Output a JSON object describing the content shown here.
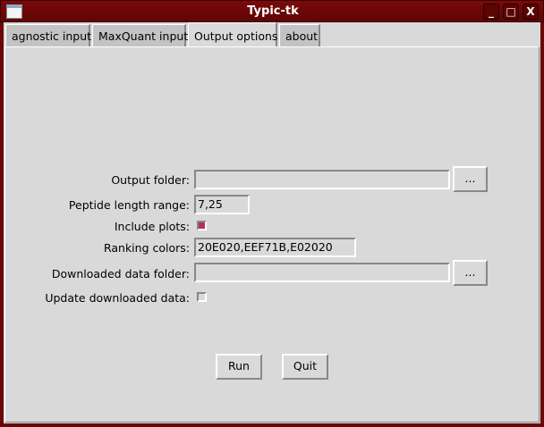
{
  "window": {
    "title": "Typic-tk",
    "minimize": "_",
    "maximize": "□",
    "close": "X"
  },
  "tabs": [
    {
      "label": "agnostic input"
    },
    {
      "label": "MaxQuant input"
    },
    {
      "label": "Output options"
    },
    {
      "label": "about"
    }
  ],
  "form": {
    "output_folder_label": "Output folder:",
    "output_folder_value": "",
    "browse_label": "...",
    "peptide_length_label": "Peptide length range:",
    "peptide_length_value": "7,25",
    "include_plots_label": "Include plots:",
    "include_plots_checked": true,
    "ranking_colors_label": "Ranking colors:",
    "ranking_colors_value": "20E020,EEF71B,E02020",
    "downloaded_folder_label": "Downloaded data folder:",
    "downloaded_folder_value": "",
    "browse2_label": "...",
    "update_label": "Update downloaded data:",
    "update_checked": false
  },
  "buttons": {
    "run": "Run",
    "quit": "Quit"
  },
  "colors": {
    "titlebar": "#6a0808",
    "checkbox_on": "#b03060"
  }
}
